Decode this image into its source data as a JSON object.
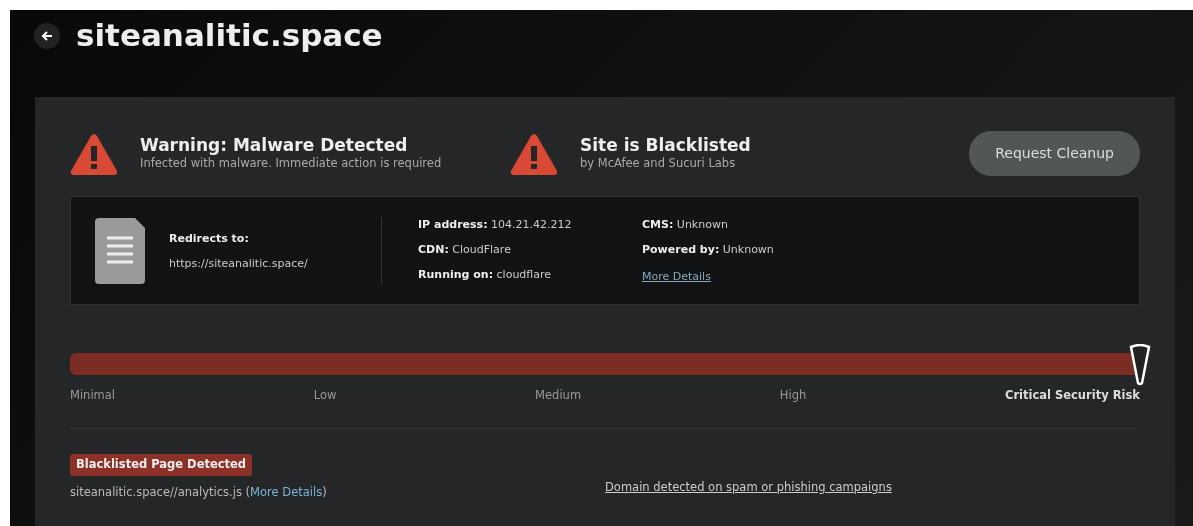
{
  "header": {
    "title": "siteanalitic.space"
  },
  "alerts": [
    {
      "title": "Warning: Malware Detected",
      "subtitle": "Infected with malware. Immediate action is required"
    },
    {
      "title": "Site is Blacklisted",
      "subtitle": "by McAfee and Sucuri Labs"
    }
  ],
  "cleanup_button": "Request Cleanup",
  "info": {
    "redirect_label": "Redirects to:",
    "redirect_url": "https://siteanalitic.space/",
    "columns": [
      [
        "**IP address:** 104.21.42.212",
        "**CDN:** CloudFlare",
        "**Running on:** cloudflare"
      ],
      [
        "**CMS:** Unknown",
        "**Powered by:** Unknown"
      ]
    ],
    "more_details": "More Details"
  },
  "risk": {
    "level": 1.0,
    "labels": [
      {
        "text": "Minimal",
        "selected": false
      },
      {
        "text": "Low",
        "selected": false
      },
      {
        "text": "Medium",
        "selected": false
      },
      {
        "text": "High",
        "selected": false
      },
      {
        "text": "Critical Security Risk",
        "selected": true
      }
    ]
  },
  "blacklist": {
    "badge": "Blacklisted Page Detected",
    "path": "siteanalitic.space//analytics.js (",
    "link": "More Details",
    "suffix": ")",
    "campaign": "Domain detected on spam or phishing campaigns"
  }
}
